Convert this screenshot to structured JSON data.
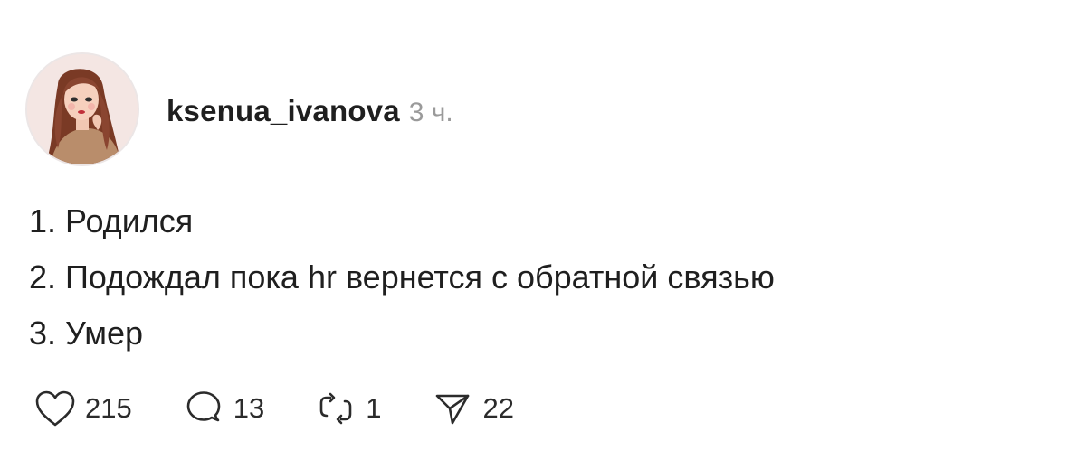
{
  "post": {
    "author": {
      "username": "ksenua_ivanova",
      "time": "3 ч."
    },
    "lines": [
      "1. Родился",
      "2. Подождал пока hr вернется с обратной связью",
      "3. Умер"
    ],
    "actions": {
      "likes": {
        "icon": "heart-icon",
        "count": "215"
      },
      "comments": {
        "icon": "comment-bubble-icon",
        "count": "13"
      },
      "reposts": {
        "icon": "repost-icon",
        "count": "1"
      },
      "shares": {
        "icon": "send-icon",
        "count": "22"
      }
    }
  }
}
